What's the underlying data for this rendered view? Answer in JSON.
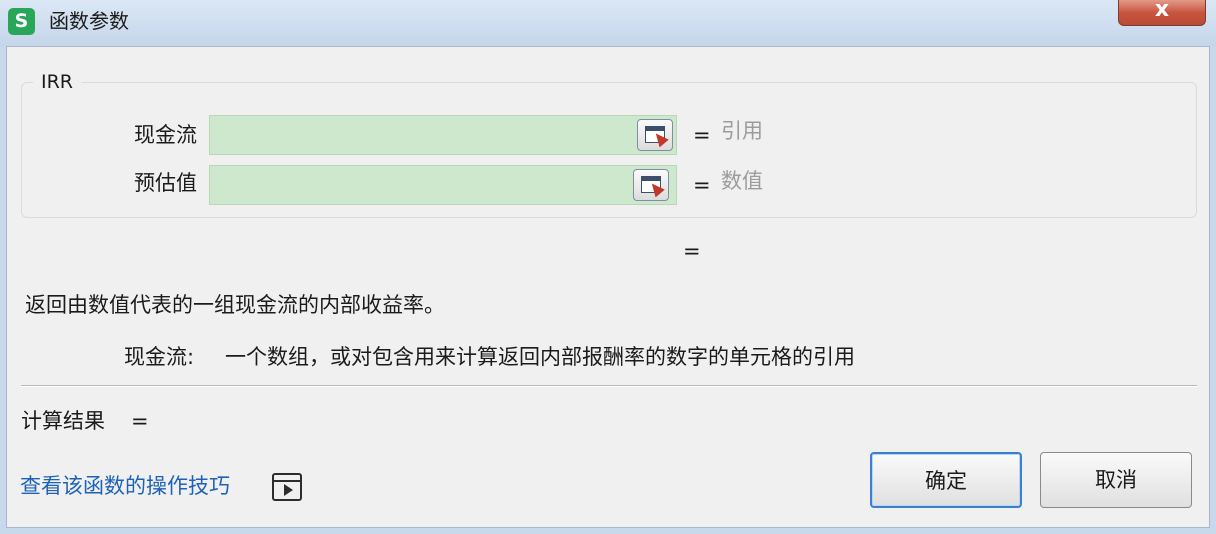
{
  "window": {
    "title": "函数参数",
    "app_icon_letter": "S",
    "close_label": "x"
  },
  "function": {
    "name": "IRR",
    "fields": [
      {
        "label": "现金流",
        "value": "",
        "hint": "引用",
        "equals": "="
      },
      {
        "label": "预估值",
        "value": "",
        "hint": "数值",
        "equals": "="
      }
    ],
    "result_equals": "="
  },
  "description": {
    "summary": "返回由数值代表的一组现金流的内部收益率。",
    "param_name": "现金流:",
    "param_desc": "一个数组，或对包含用来计算返回内部报酬率的数字的单元格的引用"
  },
  "calc": {
    "label": "计算结果",
    "equals": "="
  },
  "footer": {
    "tips_link": "查看该函数的操作技巧",
    "ok_label": "确定",
    "cancel_label": "取消"
  },
  "colors": {
    "input_bg": "#cde8cd",
    "link": "#1e62b8",
    "hint": "#9c9c9c",
    "close_button": "#c8543e",
    "app_icon": "#2aa65a"
  },
  "icons": {
    "app": "wps-spreadsheet-icon",
    "ref": "range-select-icon",
    "tips": "video-play-icon"
  }
}
